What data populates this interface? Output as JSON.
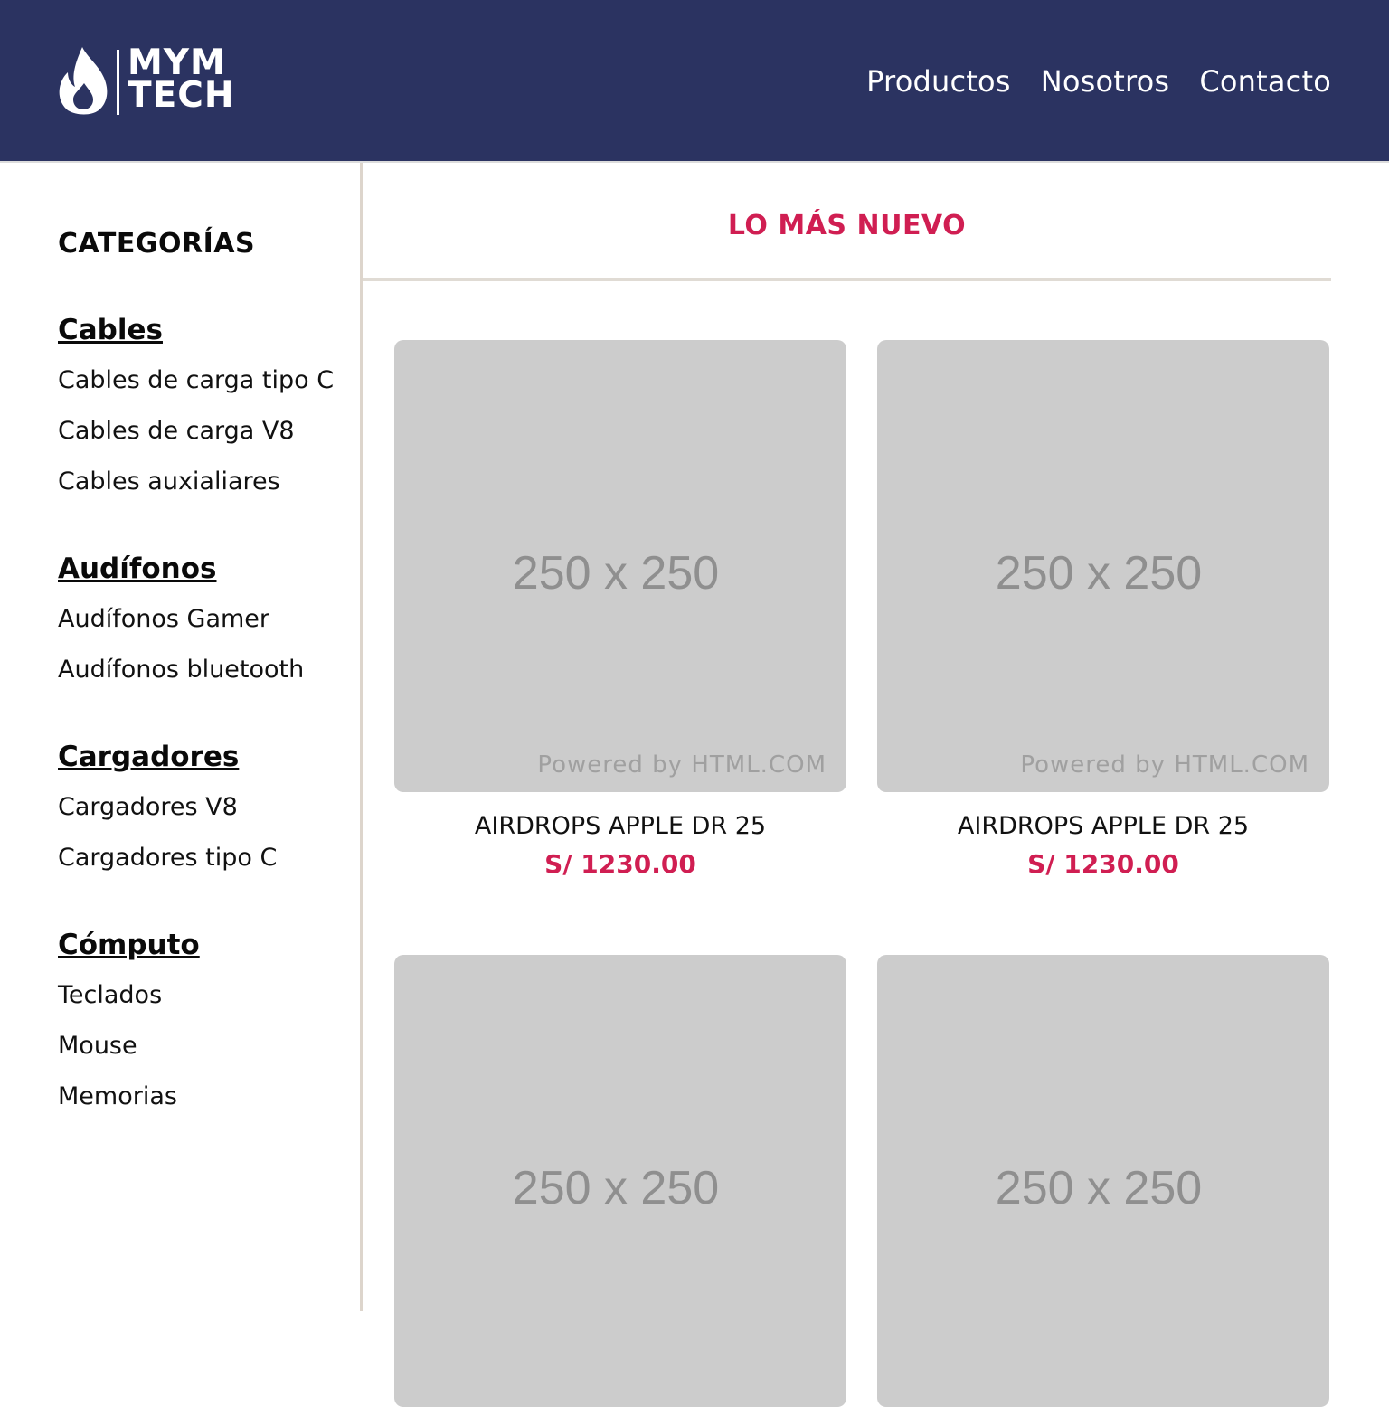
{
  "brand": {
    "line1": "MYM",
    "line2": "TECH",
    "icon": "flame-icon"
  },
  "nav": {
    "items": [
      "Productos",
      "Nosotros",
      "Contacto"
    ]
  },
  "sidebar": {
    "title": "CATEGORÍAS",
    "groups": [
      {
        "heading": "Cables",
        "items": [
          "Cables de carga tipo C",
          "Cables de carga V8",
          "Cables auxialiares"
        ]
      },
      {
        "heading": "Audífonos",
        "items": [
          "Audífonos Gamer",
          "Audífonos bluetooth"
        ]
      },
      {
        "heading": "Cargadores",
        "items": [
          "Cargadores V8",
          "Cargadores tipo C"
        ]
      },
      {
        "heading": "Cómputo",
        "items": [
          "Teclados",
          "Mouse",
          "Memorias"
        ]
      }
    ]
  },
  "main": {
    "title": "LO MÁS NUEVO",
    "products": [
      {
        "image_label": "250 x 250",
        "image_credit": "Powered by HTML.COM",
        "name": "AIRDROPS APPLE DR 25",
        "price": "S/ 1230.00"
      },
      {
        "image_label": "250 x 250",
        "image_credit": "Powered by HTML.COM",
        "name": "AIRDROPS APPLE DR 25",
        "price": "S/ 1230.00"
      },
      {
        "image_label": "250 x 250",
        "image_credit": "",
        "name": "",
        "price": ""
      },
      {
        "image_label": "250 x 250",
        "image_credit": "",
        "name": "",
        "price": ""
      }
    ]
  },
  "colors": {
    "header_bg": "#2b3361",
    "accent": "#d01e52",
    "placeholder_bg": "#cccccc",
    "divider": "#ddd5cc"
  }
}
